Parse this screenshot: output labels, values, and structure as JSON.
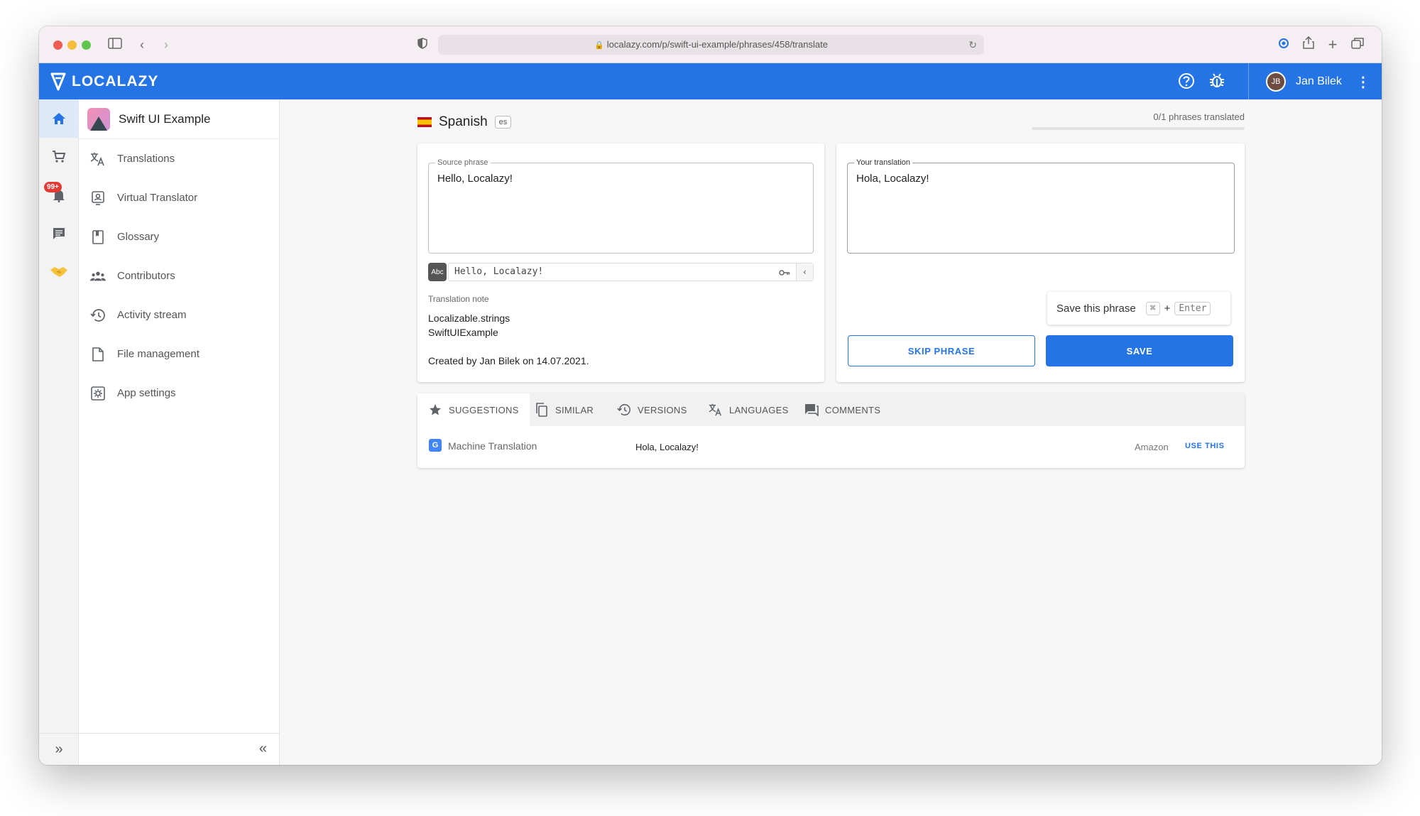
{
  "browser": {
    "url": "localazy.com/p/swift-ui-example/phrases/458/translate"
  },
  "header": {
    "brand": "LOCALAZY",
    "user_name": "Jan Bilek"
  },
  "rail": {
    "badge": "99+"
  },
  "sidebar": {
    "project_name": "Swift UI Example",
    "items": [
      {
        "label": "Translations",
        "icon": "translate-icon"
      },
      {
        "label": "Virtual Translator",
        "icon": "virtual-translator-icon"
      },
      {
        "label": "Glossary",
        "icon": "book-icon"
      },
      {
        "label": "Contributors",
        "icon": "people-icon"
      },
      {
        "label": "Activity stream",
        "icon": "history-icon"
      },
      {
        "label": "File management",
        "icon": "file-icon"
      },
      {
        "label": "App settings",
        "icon": "gear-icon"
      }
    ]
  },
  "language": {
    "name": "Spanish",
    "code": "es",
    "progress_text": "0/1 phrases translated",
    "progress": 0
  },
  "source": {
    "legend": "Source phrase",
    "text": "Hello, Localazy!",
    "preview_badge": "Abc",
    "preview_text": "Hello, Localazy!",
    "note_label": "Translation note",
    "note_lines": [
      "Localizable.strings",
      "SwiftUIExample"
    ],
    "created": "Created by Jan Bilek on 14.07.2021."
  },
  "target": {
    "legend": "Your translation",
    "text": "Hola, Localazy!",
    "shortcut_label": "Save this phrase",
    "shortcut_key1": "⌘",
    "shortcut_plus": "+",
    "shortcut_key2": "Enter",
    "skip_label": "SKIP PHRASE",
    "save_label": "SAVE"
  },
  "tabs": [
    {
      "label": "SUGGESTIONS",
      "icon": "star-icon"
    },
    {
      "label": "SIMILAR",
      "icon": "copy-icon"
    },
    {
      "label": "VERSIONS",
      "icon": "history-icon"
    },
    {
      "label": "LANGUAGES",
      "icon": "translate-icon"
    },
    {
      "label": "COMMENTS",
      "icon": "comment-icon"
    }
  ],
  "suggestion": {
    "label": "Machine Translation",
    "value": "Hola, Localazy!",
    "source": "Amazon",
    "action": "USE THIS"
  },
  "colors": {
    "brand": "#2474e6"
  }
}
